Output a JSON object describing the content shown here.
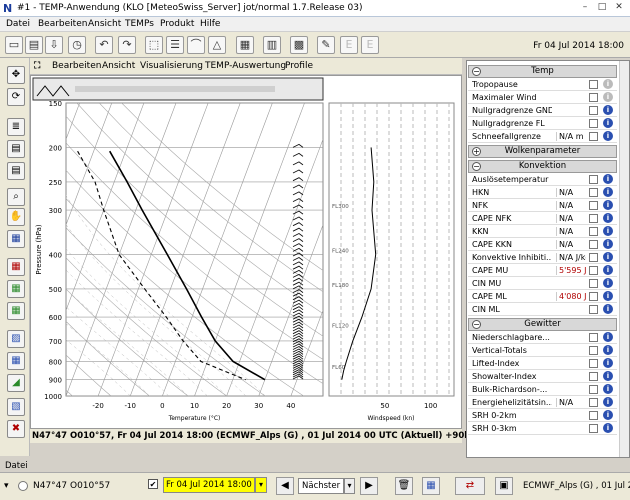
{
  "window": {
    "title": "#1 - TEMP-Anwendung (KLO [MeteoSwiss_Server] jot/normal 1.7.Release 03)"
  },
  "menu": [
    "Datei",
    "Bearbeiten",
    "Ansicht",
    "TEMPs",
    "Produkt",
    "Hilfe"
  ],
  "toolbar": {
    "date": "Fr 04 Jul 2014 18:00"
  },
  "submenu": [
    "Bearbeiten",
    "Ansicht",
    "Visualisierung",
    "TEMP-Auswertung",
    "Profile"
  ],
  "status": {
    "text": "N47°47 O010°57, Fr 04 Jul 2014 18:00 (ECMWF_Alps (G) , 01 Jul 2014 00 UTC (Aktuell) +90h)"
  },
  "tab": {
    "label": "Datei"
  },
  "bottom": {
    "coords": "N47°47 O010°57",
    "date": "Fr 04 Jul 2014 18:00",
    "next_label": "Nächster",
    "model": "ECMWF_Alps (G) , 01 Jul 20"
  },
  "chart_data": {
    "type": "line",
    "ylabel": "Pressure (hPa)",
    "xlabel": "Temperature (°C)",
    "y_ticks": [
      150,
      200,
      250,
      300,
      400,
      500,
      600,
      700,
      800,
      900,
      1000
    ],
    "x_ticks": [
      -20,
      -10,
      0,
      10,
      20,
      30,
      40
    ],
    "fl_labels": [
      "FL300",
      "FL240",
      "FL180",
      "FL120",
      "FL60"
    ],
    "wind_label": "Windspeed (kn)",
    "wind_ticks": [
      50,
      100
    ],
    "series": [
      {
        "pressure": [
          205,
          250,
          300,
          400,
          500,
          600,
          700,
          800,
          900
        ],
        "values": [
          -45,
          -36,
          -28,
          -15,
          -5,
          3,
          10,
          18,
          30
        ],
        "style": "solid"
      },
      {
        "pressure": [
          205,
          250,
          300,
          400,
          500,
          600,
          700,
          800,
          900
        ],
        "values": [
          -55,
          -46,
          -40,
          -30,
          -18,
          -8,
          0,
          8,
          24
        ],
        "style": "dashed"
      }
    ],
    "wind_profile": {
      "pressure": [
        200,
        250,
        300,
        400,
        500,
        600,
        700,
        800,
        850,
        900
      ],
      "speed": [
        35,
        38,
        36,
        40,
        35,
        25,
        15,
        8,
        5,
        3
      ]
    }
  },
  "panel": {
    "sections": [
      {
        "title": "Temp",
        "expanded": true,
        "rows": [
          {
            "label": "Tropopause",
            "value": "",
            "info": false
          },
          {
            "label": "Maximaler Wind",
            "value": "",
            "info": false
          },
          {
            "label": "Nullgradgrenze GND",
            "value": "",
            "info": true
          },
          {
            "label": "Nullgradgrenze FL",
            "value": "",
            "info": true
          },
          {
            "label": "Schneefallgrenze",
            "value": "N/A m",
            "info": true
          }
        ]
      },
      {
        "title": "Wolkenparameter",
        "expanded": false,
        "rows": []
      },
      {
        "title": "Konvektion",
        "expanded": true,
        "rows": [
          {
            "label": "Auslösetemperatur",
            "value": "",
            "info": true
          },
          {
            "label": "HKN",
            "value": "N/A",
            "info": true
          },
          {
            "label": "NFK",
            "value": "N/A",
            "info": true
          },
          {
            "label": "CAPE NFK",
            "value": "N/A",
            "info": true
          },
          {
            "label": "KKN",
            "value": "N/A",
            "info": true
          },
          {
            "label": "CAPE KKN",
            "value": "N/A",
            "info": true
          },
          {
            "label": "Konvektive Inhibiti...",
            "value": "N/A J/kg",
            "info": true
          },
          {
            "label": "CAPE MU",
            "value": "5'595 J/...",
            "info": true,
            "red": true
          },
          {
            "label": "CIN MU",
            "value": "",
            "info": true
          },
          {
            "label": "CAPE ML",
            "value": "4'080 J/...",
            "info": true,
            "red": true
          },
          {
            "label": "CIN ML",
            "value": "",
            "info": true
          }
        ]
      },
      {
        "title": "Gewitter",
        "expanded": true,
        "rows": [
          {
            "label": "Niederschlagbare...",
            "value": "",
            "info": true
          },
          {
            "label": "Vertical-Totals",
            "value": "",
            "info": true
          },
          {
            "label": "Lifted-Index",
            "value": "",
            "info": true
          },
          {
            "label": "Showalter-Index",
            "value": "",
            "info": true
          },
          {
            "label": "Bulk-Richardson-...",
            "value": "",
            "info": true
          },
          {
            "label": "Energiehelizitätsin...",
            "value": "N/A",
            "info": true
          },
          {
            "label": "SRH 0-2km",
            "value": "",
            "info": true
          },
          {
            "label": "SRH 0-3km",
            "value": "",
            "info": true
          }
        ]
      }
    ]
  }
}
